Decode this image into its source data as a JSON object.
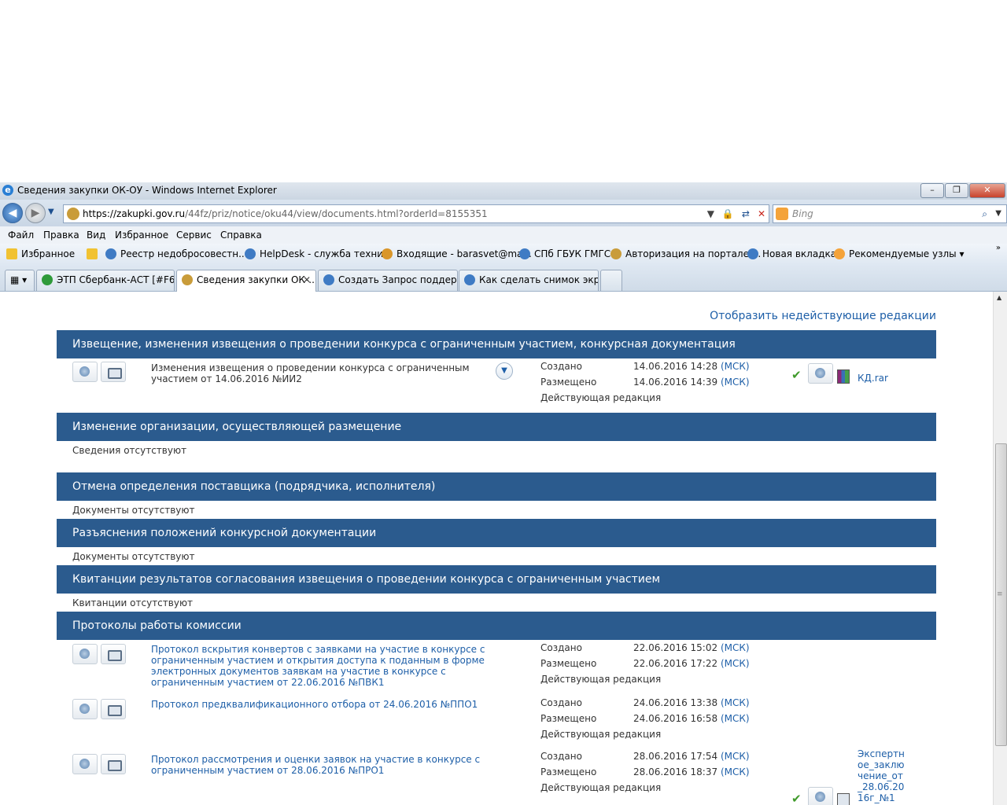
{
  "window": {
    "title": "Сведения закупки ОК-ОУ - Windows Internet Explorer"
  },
  "address": {
    "url_main": "https://zakupki.gov.ru",
    "url_rest": "/44fz/priz/notice/oku44/view/documents.html?orderId=8155351",
    "search_placeholder": "Bing"
  },
  "menu": [
    "Файл",
    "Правка",
    "Вид",
    "Избранное",
    "Сервис",
    "Справка"
  ],
  "favorites": {
    "label": "Избранное",
    "items": [
      "Реестр недобросовестн...",
      "HelpDesk - служба техни...",
      "Входящие - barasvet@ma...",
      "СПб ГБУК ГМГС",
      "Авторизация на портале ...",
      "Новая вкладка",
      "Рекомендуемые узлы"
    ]
  },
  "tabs": [
    "ЭТП Сбербанк-АСТ [#F6]",
    "Сведения закупки ОК-...",
    "Создать Запрос поддерж...",
    "Как сделать снимок экра..."
  ],
  "page": {
    "top_link": "Отобразить недействующие редакции",
    "labels": {
      "created": "Создано",
      "posted": "Размещено",
      "current": "Действующая редакция",
      "tz": "(МСК)"
    },
    "sections": [
      {
        "title": "Извещение, изменения извещения о проведении конкурса с ограниченным участием, конкурсная документация"
      },
      {
        "title": "Изменение организации, осуществляющей размещение",
        "empty": "Сведения отсутствуют"
      },
      {
        "title": "Отмена определения поставщика (подрядчика, исполнителя)",
        "empty": "Документы отсутствуют"
      },
      {
        "title": "Разъяснения положений конкурсной документации",
        "empty": "Документы отсутствуют"
      },
      {
        "title": "Квитанции результатов согласования извещения о проведении конкурса с ограниченным участием",
        "empty": "Квитанции отсутствуют"
      },
      {
        "title": "Протоколы работы комиссии"
      }
    ],
    "notice_doc": {
      "name": "Изменения извещения о проведении конкурса с ограниченным участием от 14.06.2016 №ИИ2",
      "created": "14.06.2016 14:28",
      "posted": "14.06.2016 14:39",
      "file": "КД.rar"
    },
    "protocols": [
      {
        "name": "Протокол вскрытия конвертов с заявками на участие в конкурсе с ограниченным участием и открытия доступа к поданным в форме электронных документов заявкам на участие в конкурсе с ограниченным участием от 22.06.2016 №ПВК1",
        "created": "22.06.2016 15:02",
        "posted": "22.06.2016 17:22"
      },
      {
        "name": "Протокол предквалификационного отбора от 24.06.2016 №ППО1",
        "created": "24.06.2016 13:38",
        "posted": "24.06.2016 16:58"
      },
      {
        "name": "Протокол рассмотрения и оценки заявок на участие в конкурсе с ограниченным участием от 28.06.2016 №ПРО1",
        "created": "28.06.2016 17:54",
        "posted": "28.06.2016 18:37",
        "file": "Экспертное_заключение_от_28.06.2016г_№1"
      }
    ]
  }
}
